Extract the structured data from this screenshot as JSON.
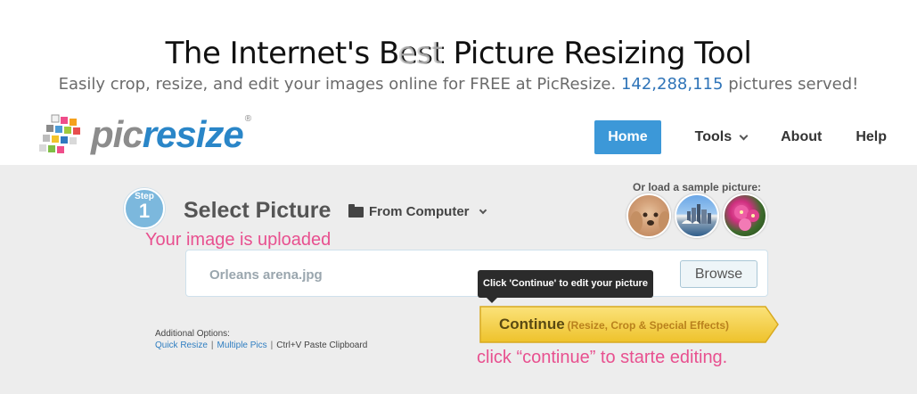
{
  "header": {
    "headline": "The Internet's Best",
    "headline_overlap": "est",
    "headline_rest": "Picture Resizing Tool",
    "tagline": "Easily crop, resize, and edit your images online for FREE at PicResize.",
    "picture_count": "142,288,115",
    "count_suffix": "pictures served!"
  },
  "logo": {
    "part1": "pic",
    "part2": "resize",
    "registered": "®"
  },
  "nav": {
    "items": [
      {
        "label": "Home",
        "active": true
      },
      {
        "label": "Tools",
        "dropdown": true
      },
      {
        "label": "About"
      },
      {
        "label": "Help"
      }
    ]
  },
  "step": {
    "word": "Step",
    "number": "1",
    "title": "Select Picture",
    "source_label": "From Computer"
  },
  "samples": {
    "label": "Or load a sample picture:",
    "thumbs": [
      "dog-photo",
      "city-skyline-photo",
      "pink-flower-photo"
    ]
  },
  "file": {
    "name": "Orleans arena.jpg",
    "browse_label": "Browse"
  },
  "tooltip": "Click 'Continue' to edit your picture",
  "continue_button": {
    "label": "Continue",
    "sub": "(Resize, Crop & Special Effects)"
  },
  "additional": {
    "heading": "Additional Options:",
    "quick_resize": "Quick Resize",
    "sep": "|",
    "multiple_pics": "Multiple Pics",
    "paste": "Ctrl+V Paste Clipboard"
  },
  "annotations": {
    "upload": "Your image is uploaded",
    "continue": "click “continue” to starte editing."
  },
  "colors": {
    "accent_blue": "#3c98d8",
    "annotation_pink": "#e8508f",
    "continue_yellow": "#f3cf3a",
    "panel_gray": "#ededed"
  }
}
